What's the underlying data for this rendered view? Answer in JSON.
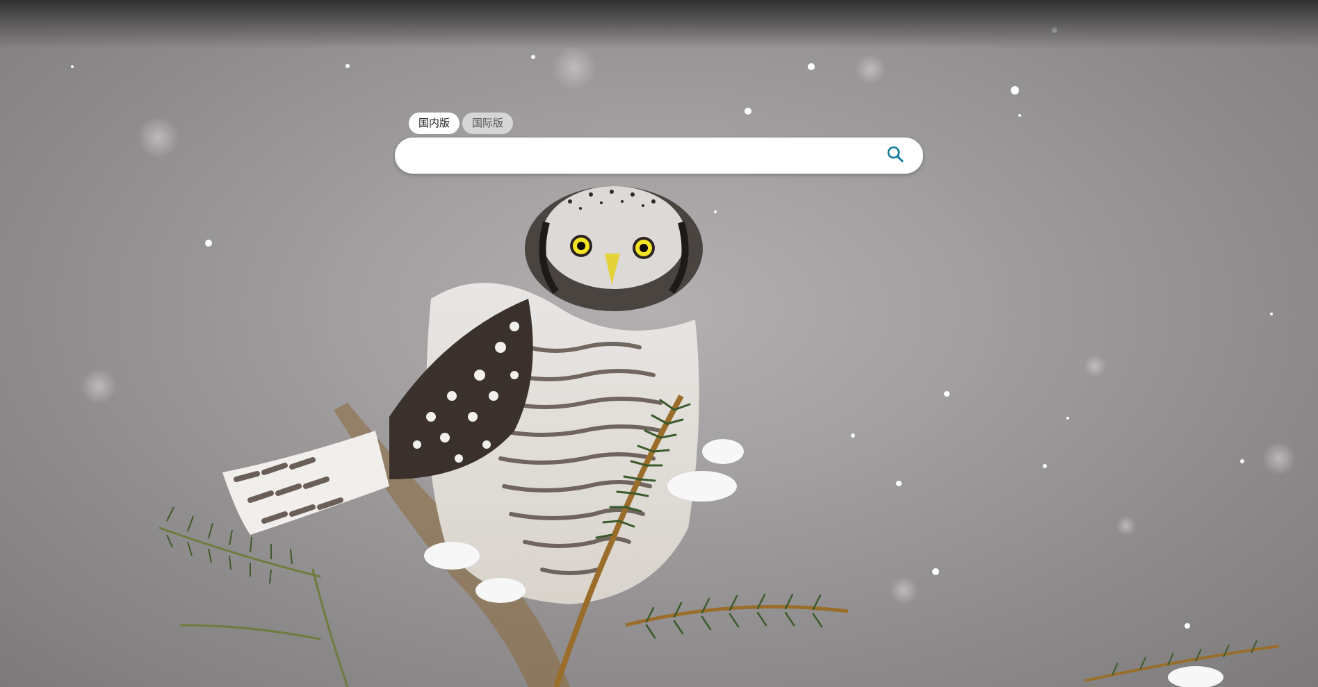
{
  "tabs": [
    {
      "label": "国内版",
      "active": true
    },
    {
      "label": "国际版",
      "active": false
    }
  ],
  "search": {
    "value": "",
    "placeholder": ""
  },
  "icons": {
    "search": "search-icon"
  },
  "colors": {
    "search_icon": "#0e7a9b",
    "background": "#a19e9f"
  }
}
